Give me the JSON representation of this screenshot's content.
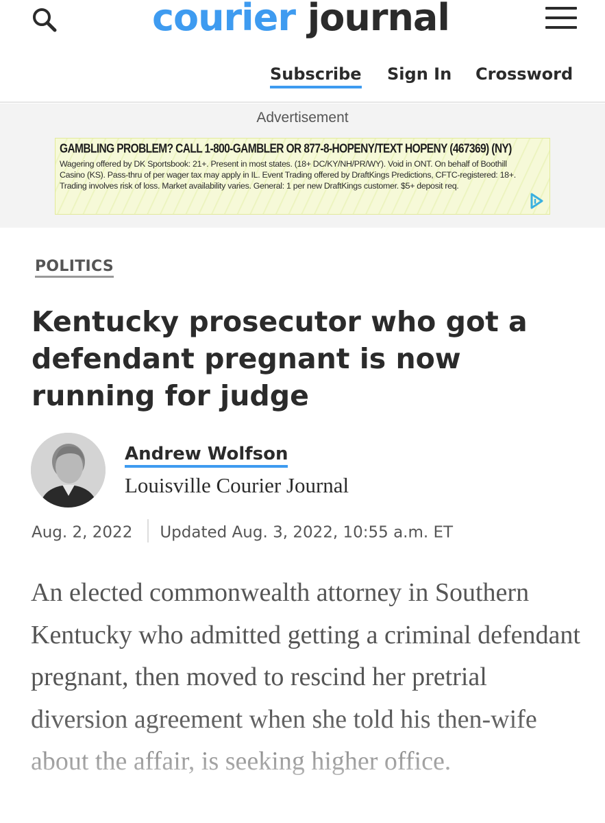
{
  "header": {
    "brand_part1": "courier",
    "brand_part2": "journal",
    "nav": {
      "subscribe": "Subscribe",
      "sign_in": "Sign In",
      "crossword": "Crossword"
    },
    "search_icon": "search-icon",
    "menu_icon": "hamburger-menu-icon"
  },
  "ad": {
    "label": "Advertisement",
    "headline": "GAMBLING PROBLEM? CALL 1-800-GAMBLER OR 877-8-HOPENY/TEXT HOPENY (467369) (NY)",
    "text": "Wagering offered by DK Sportsbook: 21+. Present in most states. (18+ DC/KY/NH/PR/WY). Void in ONT. On behalf of Boothill Casino (KS). Pass-thru of per wager tax may apply in IL. Event Trading offered by DraftKings Predictions, CFTC-registered: 18+. Trading involves risk of loss. Market availability varies. General: 1 per new DraftKings customer. $5+ deposit req.",
    "choice_icon": "ad-choices-icon"
  },
  "article": {
    "category": "POLITICS",
    "headline": "Kentucky prosecutor who got a defendant pregnant is now running for judge",
    "author": {
      "name": "Andrew Wolfson",
      "organization": "Louisville Courier Journal"
    },
    "published": "Aug. 2, 2022",
    "updated": "Updated Aug. 3, 2022, 10:55 a.m. ET",
    "body": "An elected commonwealth attorney in Southern Kentucky who admitted getting a criminal defendant pregnant, then moved to rescind her pretrial diversion agreement when she told his then-wife about the affair, is seeking higher office."
  },
  "colors": {
    "accent_blue": "#3e9bf0",
    "text_dark": "#2b2b2b",
    "text_muted": "#555555",
    "ad_background": "#f3f3f3"
  }
}
